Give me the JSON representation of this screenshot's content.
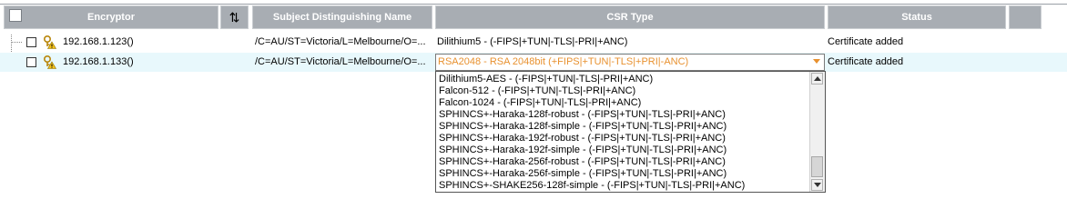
{
  "header": {
    "encryptor": "Encryptor",
    "sort_glyph": "⇅",
    "subject": "Subject Distinguishing Name",
    "csr_type": "CSR Type",
    "status": "Status"
  },
  "rows": [
    {
      "ip": "192.168.1.123()",
      "subject": "/C=AU/ST=Victoria/L=Melbourne/O=...",
      "csr": "Dilithium5 -  (-FIPS|+TUN|-TLS|-PRI|+ANC)",
      "status": "Certificate added",
      "icon": "key-warning-icon"
    },
    {
      "ip": "192.168.1.133()",
      "subject": "/C=AU/ST=Victoria/L=Melbourne/O=...",
      "csr": "RSA2048 - RSA 2048bit (+FIPS|+TUN|-TLS|+PRI|-ANC)",
      "status": "Certificate added",
      "icon": "key-warning-icon"
    }
  ],
  "dropdown_options": [
    "Dilithium5-AES -  (-FIPS|+TUN|-TLS|-PRI|+ANC)",
    "Falcon-512 -  (-FIPS|+TUN|-TLS|-PRI|+ANC)",
    "Falcon-1024 -  (-FIPS|+TUN|-TLS|-PRI|+ANC)",
    "SPHINCS+-Haraka-128f-robust -  (-FIPS|+TUN|-TLS|-PRI|+ANC)",
    "SPHINCS+-Haraka-128f-simple -  (-FIPS|+TUN|-TLS|-PRI|+ANC)",
    "SPHINCS+-Haraka-192f-robust -  (-FIPS|+TUN|-TLS|-PRI|+ANC)",
    "SPHINCS+-Haraka-192f-simple -  (-FIPS|+TUN|-TLS|-PRI|+ANC)",
    "SPHINCS+-Haraka-256f-robust -  (-FIPS|+TUN|-TLS|-PRI|+ANC)",
    "SPHINCS+-Haraka-256f-simple -  (-FIPS|+TUN|-TLS|-PRI|+ANC)",
    "SPHINCS+-SHAKE256-128f-simple -  (-FIPS|+TUN|-TLS|-PRI|+ANC)"
  ],
  "colors": {
    "header_bg": "#a8adb3",
    "selected_value": "#e8912f",
    "row_highlight": "#e8f8fc"
  }
}
